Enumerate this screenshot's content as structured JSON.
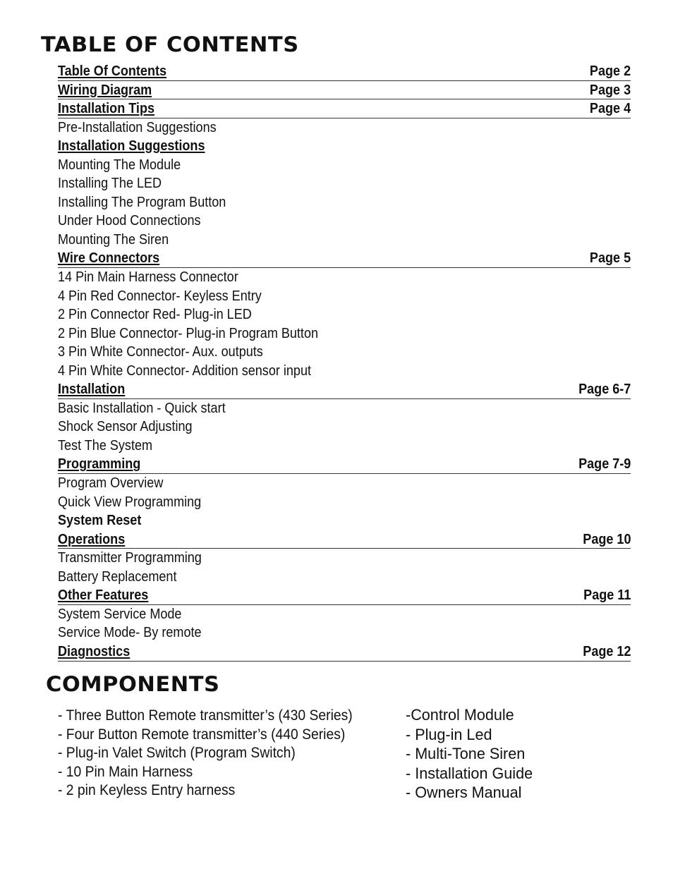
{
  "toc_title": "TABLE OF CONTENTS",
  "toc": [
    {
      "label": "Table Of Contents",
      "page": "Page 2",
      "type": "section"
    },
    {
      "label": "Wiring Diagram",
      "page": "Page 3",
      "type": "section"
    },
    {
      "label": "Installation Tips",
      "page": "Page 4",
      "type": "section"
    },
    {
      "label": "Pre-Installation Suggestions",
      "page": "",
      "type": "item"
    },
    {
      "label": "Installation Suggestions",
      "page": "",
      "type": "subsection"
    },
    {
      "label": "Mounting The Module",
      "page": "",
      "type": "item"
    },
    {
      "label": "Installing The LED",
      "page": "",
      "type": "item"
    },
    {
      "label": "Installing The Program Button",
      "page": "",
      "type": "item"
    },
    {
      "label": "Under Hood Connections",
      "page": "",
      "type": "item"
    },
    {
      "label": "Mounting The Siren",
      "page": "",
      "type": "item"
    },
    {
      "label": "Wire Connectors",
      "page": "Page 5",
      "type": "section"
    },
    {
      "label": "14 Pin Main Harness Connector",
      "page": "",
      "type": "item"
    },
    {
      "label": "4 Pin Red Connector- Keyless Entry",
      "page": "",
      "type": "item"
    },
    {
      "label": "2 Pin Connector Red- Plug-in LED",
      "page": "",
      "type": "item"
    },
    {
      "label": "2 Pin Blue Connector- Plug-in Program Button",
      "page": "",
      "type": "item"
    },
    {
      "label": "3 Pin White Connector- Aux. outputs",
      "page": "",
      "type": "item"
    },
    {
      "label": "4 Pin White Connector- Addition sensor input",
      "page": "",
      "type": "item"
    },
    {
      "label": "Installation",
      "page": "Page 6-7",
      "type": "section"
    },
    {
      "label": "Basic Installation - Quick start",
      "page": "",
      "type": "item"
    },
    {
      "label": "Shock Sensor Adjusting",
      "page": "",
      "type": "item"
    },
    {
      "label": "Test The System",
      "page": "",
      "type": "item"
    },
    {
      "label": "Programming",
      "page": "Page  7-9",
      "type": "section"
    },
    {
      "label": "Program Overview",
      "page": "",
      "type": "item"
    },
    {
      "label": "Quick View Programming",
      "page": "",
      "type": "item"
    },
    {
      "label": "System Reset",
      "page": "",
      "type": "bold"
    },
    {
      "label": "Operations",
      "page": "Page 10",
      "type": "section"
    },
    {
      "label": "Transmitter Programming",
      "page": "",
      "type": "item"
    },
    {
      "label": "Battery Replacement",
      "page": "",
      "type": "item"
    },
    {
      "label": "Other Features",
      "page": "Page 11",
      "type": "section"
    },
    {
      "label": "System Service Mode",
      "page": "",
      "type": "item"
    },
    {
      "label": "Service Mode- By remote",
      "page": "",
      "type": "item"
    },
    {
      "label": "Diagnostics",
      "page": "Page 12",
      "type": "section"
    }
  ],
  "components_title": "COMPONENTS",
  "components_left": [
    "- Three Button Remote transmitter’s (430 Series)",
    "- Four Button Remote transmitter’s (440 Series)",
    "- Plug-in Valet Switch (Program Switch)",
    "- 10 Pin Main Harness",
    "- 2 pin Keyless Entry harness"
  ],
  "components_right": [
    "-Control Module",
    "- Plug-in Led",
    "- Multi-Tone Siren",
    "- Installation Guide",
    "- Owners Manual"
  ]
}
